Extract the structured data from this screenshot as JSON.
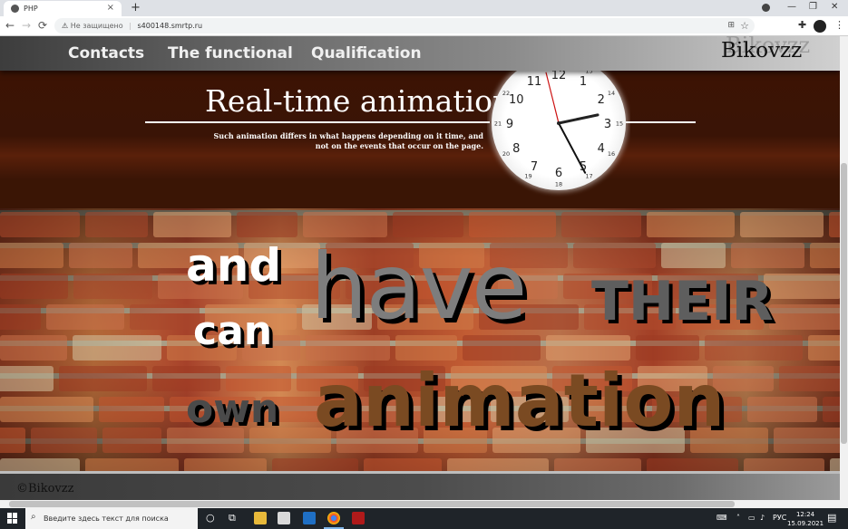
{
  "browser": {
    "tab_title": "PHP",
    "tab_close": "×",
    "new_tab": "+",
    "security_label": "Не защищено",
    "url": "s400148.smrtp.ru",
    "back": "←",
    "forward": "→",
    "reload": "⟳"
  },
  "site": {
    "menu": [
      "Contacts",
      "The functional",
      "Qualification"
    ],
    "logo": "Bikovzz",
    "hero_title": "Real-time animation",
    "hero_desc": "Such animation differs in what happens depending on it time, and not on the events that occur on the page.",
    "wall_words": {
      "and": "and",
      "can": "can",
      "own": "own",
      "have": "have",
      "their": "THEIR",
      "animation": "animation"
    },
    "footer": "©Bikovzz"
  },
  "clock": {
    "hours12": [
      "12",
      "1",
      "2",
      "3",
      "4",
      "5",
      "6",
      "7",
      "8",
      "9",
      "10",
      "11"
    ],
    "hours24": [
      "13",
      "14",
      "15",
      "16",
      "17",
      "18",
      "19",
      "20",
      "21",
      "22"
    ]
  },
  "taskbar": {
    "search_placeholder": "Введите здесь текст для поиска",
    "lang": "РУС",
    "time": "12:24",
    "date": "15.09.2021"
  },
  "colors": {
    "hero_bg": "#3a1406",
    "have_text": "#7d7d7d",
    "animation_text": "#7a4a22",
    "second_hand": "#cc1111"
  }
}
